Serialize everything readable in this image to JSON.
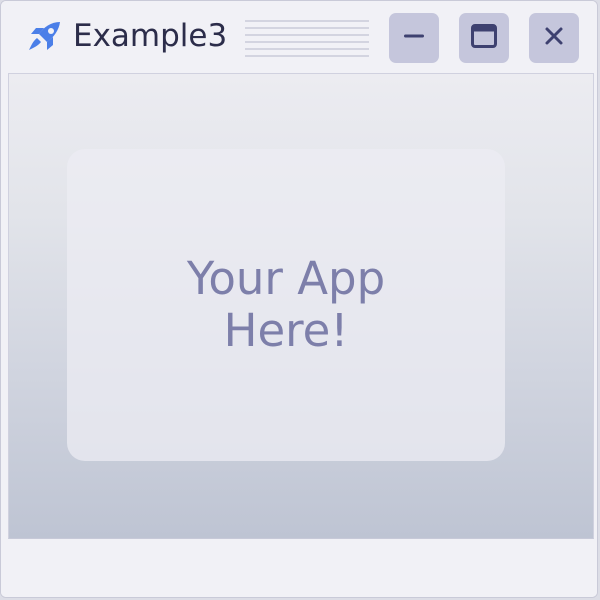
{
  "window": {
    "title": "Example3",
    "icon": "rocket-icon",
    "controls": {
      "minimize": "minimize-icon",
      "maximize": "maximize-icon",
      "close": "close-icon"
    }
  },
  "content": {
    "placeholder_text": "Your App Here!"
  },
  "colors": {
    "accent": "#4b7fe8",
    "title_text": "#2c2d4a",
    "control_bg": "#c5c6dc",
    "control_glyph": "#3e4170",
    "placeholder_text": "#7d7faa"
  }
}
